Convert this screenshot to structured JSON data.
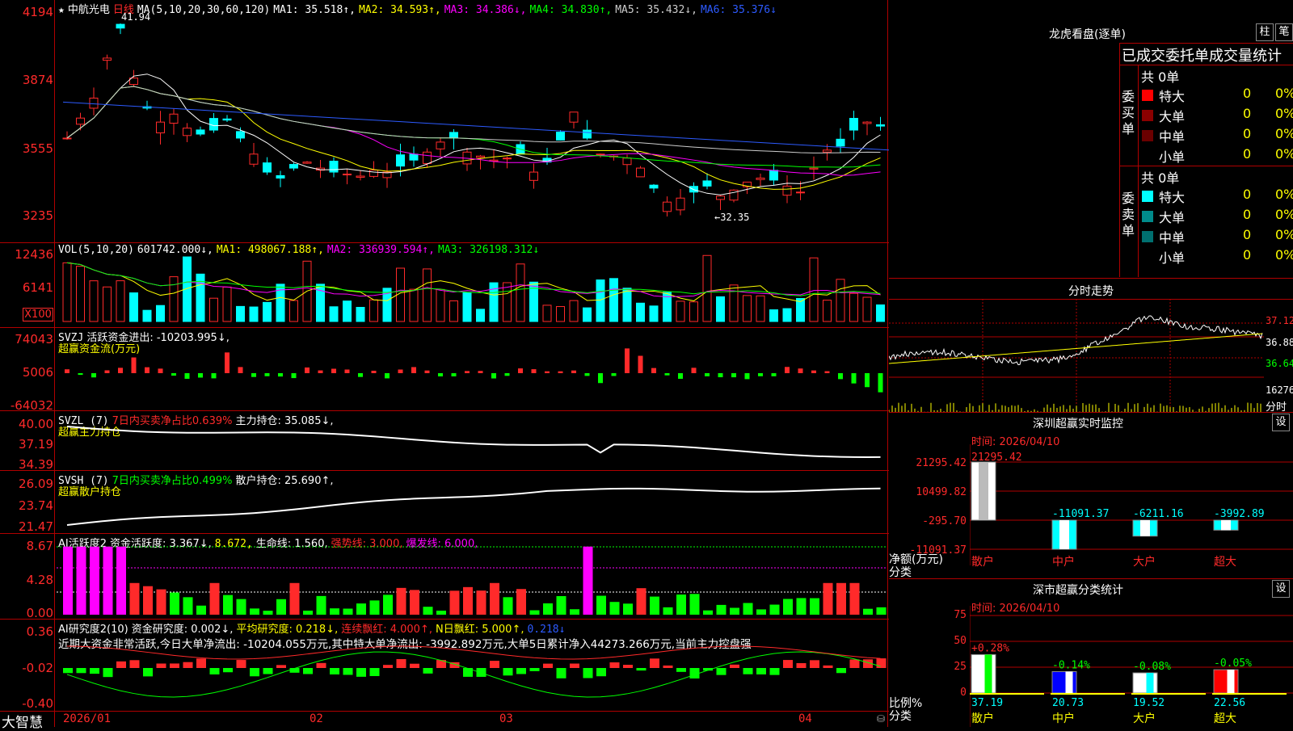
{
  "stock": {
    "star": "★",
    "name": "中航光电",
    "period": "日线"
  },
  "ma_line": {
    "label": "MA(5,10,20,30,60,120)",
    "ma1": "MA1: 35.518↑,",
    "ma2": "MA2: 34.593↑,",
    "ma3": "MA3: 34.386↓,",
    "ma4": "MA4: 34.830↑,",
    "ma5": "MA5: 35.432↓,",
    "ma6": "MA6: 35.376↓"
  },
  "price_axis": [
    "4194",
    "3874",
    "3555",
    "3235"
  ],
  "price_high_mark": "41.94",
  "price_low_mark": "←32.35",
  "vol": {
    "axis": [
      "12436",
      "6141"
    ],
    "unit": "X100",
    "label": "VOL(5,10,20)",
    "value": "601742.000↓,",
    "ma1": "MA1: 498067.188↑,",
    "ma2": "MA2: 336939.594↑,",
    "ma3": "MA3: 326198.312↓"
  },
  "svzj": {
    "axis": [
      "74043",
      "5006",
      "-64032"
    ],
    "label": "SVZJ",
    "text": "活跃资金进出: -10203.995↓,",
    "sub": "超赢资金流(万元)"
  },
  "svzl": {
    "axis": [
      "40.00",
      "37.19",
      "34.39"
    ],
    "label": "SVZL (7)",
    "ratio": "7日内买卖净占比0.639%",
    "hold": "主力持仓: 35.085↓,",
    "sub": "超赢主力持仓"
  },
  "svsh": {
    "axis": [
      "26.09",
      "23.74",
      "21.47"
    ],
    "label": "SVSH (7)",
    "ratio": "7日内买卖净占比0.499%",
    "hold": "散户持仓: 25.690↑,",
    "sub": "超赢散户持仓"
  },
  "ai_active": {
    "axis": [
      "8.67",
      "4.28",
      "0.00"
    ],
    "label": "AI活跃度2",
    "fund": "资金活跃度: 3.367↓,",
    "v2": "8.672,",
    "life": "生命线: 1.560,",
    "strong": "强势线: 3.000,",
    "burst": "爆发线: 6.000,"
  },
  "ai_research": {
    "axis": [
      "0.36",
      "-0.02",
      "-0.40"
    ],
    "label": "AI研究度2(10)",
    "fund": "资金研究度: 0.002↓,",
    "avg": "平均研究度: 0.218↓,",
    "cont": "连续飘红: 4.000↑,",
    "nday": "N日飘红: 5.000↑,",
    "last": "0.218↓",
    "comment": "近期大资金非常活跃,今日大单净流出: -10204.055万元,其中特大单净流出: -3992.892万元,大单5日累计净入44273.266万元,当前主力控盘强"
  },
  "date_axis": [
    "2026/01",
    "02",
    "03",
    "04"
  ],
  "brand": "大智慧",
  "dragon": {
    "title": "龙虎看盘(逐单)",
    "btn1": "柱",
    "btn2": "笔",
    "header": "已成交委托单成交量统计",
    "buy_label": "委买单",
    "sell_label": "委卖单",
    "buy_total": "共 0单",
    "sell_total": "共 0单",
    "buy_rows": [
      {
        "name": "特大",
        "count": "0",
        "pct": "0%",
        "color": "#ff0000"
      },
      {
        "name": "大单",
        "count": "0",
        "pct": "0%",
        "color": "#8b0000"
      },
      {
        "name": "中单",
        "count": "0",
        "pct": "0%",
        "color": "#6b0000"
      },
      {
        "name": "小单",
        "count": "0",
        "pct": "0%",
        "color": "#000000"
      }
    ],
    "sell_rows": [
      {
        "name": "特大",
        "count": "0",
        "pct": "0%",
        "color": "#00ffff"
      },
      {
        "name": "大单",
        "count": "0",
        "pct": "0%",
        "color": "#008b8b"
      },
      {
        "name": "中单",
        "count": "0",
        "pct": "0%",
        "color": "#007070"
      },
      {
        "name": "小单",
        "count": "0",
        "pct": "0%",
        "color": "#000000"
      }
    ]
  },
  "intraday": {
    "title": "分时走势",
    "axis": [
      "37.12",
      "36.88",
      "36.64"
    ],
    "vol_label": "16276",
    "unit": "分时"
  },
  "monitor": {
    "title": "深圳超赢实时监控",
    "btn": "设",
    "time": "时间: 2026/04/10",
    "axis": [
      "21295.42",
      "10499.82",
      "-295.70",
      "-11091.37"
    ],
    "y_label": "净额(万元)",
    "x_label": "分类",
    "bars": [
      {
        "cat": "散户",
        "value": 21295.42,
        "label": "21295.42"
      },
      {
        "cat": "中户",
        "value": -11091.37,
        "label": "-11091.37"
      },
      {
        "cat": "大户",
        "value": -6211.16,
        "label": "-6211.16"
      },
      {
        "cat": "超大",
        "value": -3992.89,
        "label": "-3992.89"
      }
    ]
  },
  "stats": {
    "title": "深市超赢分类统计",
    "btn": "设",
    "time": "时间: 2026/04/10",
    "axis": [
      "75",
      "50",
      "25",
      "0"
    ],
    "y_label": "比例%",
    "x_label": "分类",
    "bars": [
      {
        "cat": "散户",
        "value": 37.19,
        "label": "37.19",
        "change": "+0.28%"
      },
      {
        "cat": "中户",
        "value": 20.73,
        "label": "20.73",
        "change": "-0.14%"
      },
      {
        "cat": "大户",
        "value": 19.52,
        "label": "19.52",
        "change": "-0.08%"
      },
      {
        "cat": "超大",
        "value": 22.56,
        "label": "22.56",
        "change": "-0.05%"
      }
    ]
  },
  "colors": {
    "up": "#ff2a2a",
    "down": "#00ffff",
    "green": "#00ff00",
    "magenta": "#ff00ff",
    "yellow": "#ffff00",
    "grid": "#b00000"
  }
}
